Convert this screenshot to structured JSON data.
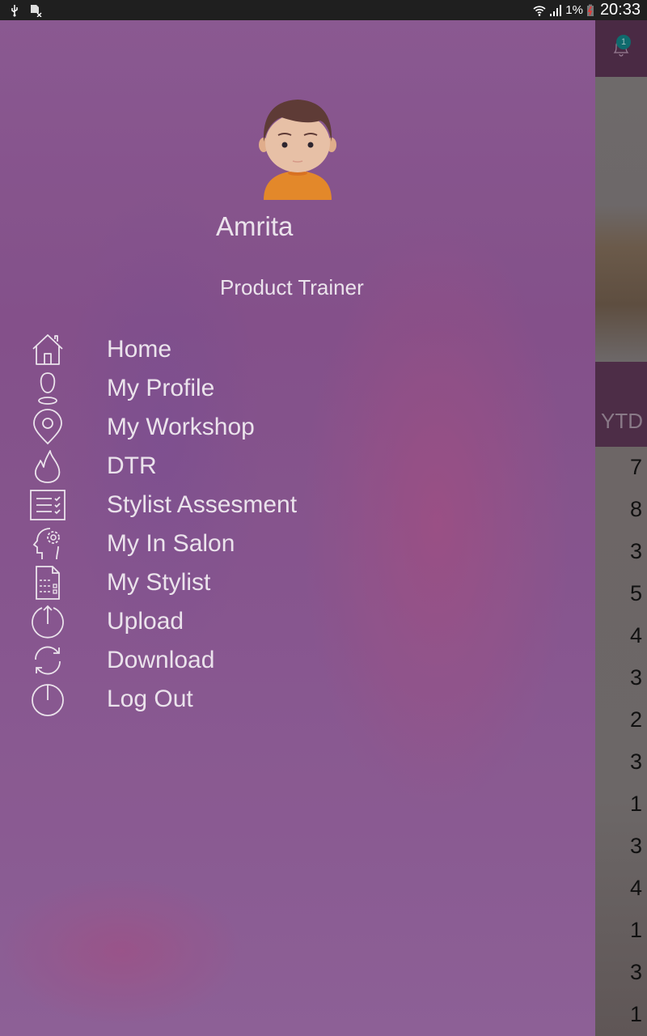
{
  "status_bar": {
    "left_icons": [
      "usb-icon",
      "no-sim-icon"
    ],
    "right_icons": [
      "wifi-icon",
      "signal-icon"
    ],
    "battery_percent": "1%",
    "time": "20:33"
  },
  "drawer": {
    "user": {
      "name": "Amrita",
      "role": "Product Trainer",
      "avatar_icon": "avatar-boy-icon"
    },
    "menu_items": [
      {
        "label": "Home",
        "icon": "home-icon"
      },
      {
        "label": "My Profile",
        "icon": "profile-icon"
      },
      {
        "label": "My Workshop",
        "icon": "location-pin-icon"
      },
      {
        "label": "DTR",
        "icon": "flame-icon"
      },
      {
        "label": "Stylist Assesment",
        "icon": "checklist-icon"
      },
      {
        "label": "My In Salon",
        "icon": "head-gear-icon"
      },
      {
        "label": "My Stylist",
        "icon": "document-checklist-icon"
      },
      {
        "label": "Upload",
        "icon": "upload-icon"
      },
      {
        "label": "Download",
        "icon": "sync-icon"
      },
      {
        "label": "Log Out",
        "icon": "power-icon"
      }
    ],
    "accent_color": "#8a5a92"
  },
  "background_screen": {
    "notification_count": "1",
    "column_header": "YTD",
    "values": [
      "7",
      "8",
      "3",
      "5",
      "4",
      "3",
      "2",
      "3",
      "1",
      "3",
      "4",
      "1",
      "3",
      "1"
    ]
  }
}
